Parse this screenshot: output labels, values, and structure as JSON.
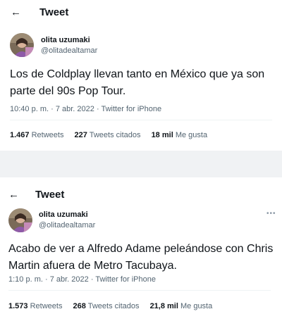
{
  "icons": {
    "back": "back-arrow-icon",
    "more": "more-icon"
  },
  "colors": {
    "text": "#0f1419",
    "secondary": "#536471",
    "gap": "#f0f2f4"
  },
  "tweets": [
    {
      "header_title": "Tweet",
      "display_name": "olita uzumaki",
      "handle": "@olitadealtamar",
      "text": "Los de Coldplay llevan tanto en México que ya son parte del 90s Pop Tour.",
      "time": "10:40 p. m.",
      "date": "7 abr. 2022",
      "source": "Twitter for iPhone",
      "retweets": "1.467",
      "retweets_label": "Retweets",
      "quotes": "227",
      "quotes_label": "Tweets citados",
      "likes": "18 mil",
      "likes_label": "Me gusta"
    },
    {
      "header_title": "Tweet",
      "display_name": "olita uzumaki",
      "handle": "@olitadealtamar",
      "text": "Acabo de ver a Alfredo Adame peleándose con Chris Martin afuera de Metro Tacubaya.",
      "time": "1:10 p. m.",
      "date": "7 abr. 2022",
      "source": "Twitter for iPhone",
      "retweets": "1.573",
      "retweets_label": "Retweets",
      "quotes": "268",
      "quotes_label": "Tweets citados",
      "likes": "21,8 mil",
      "likes_label": "Me gusta"
    }
  ]
}
